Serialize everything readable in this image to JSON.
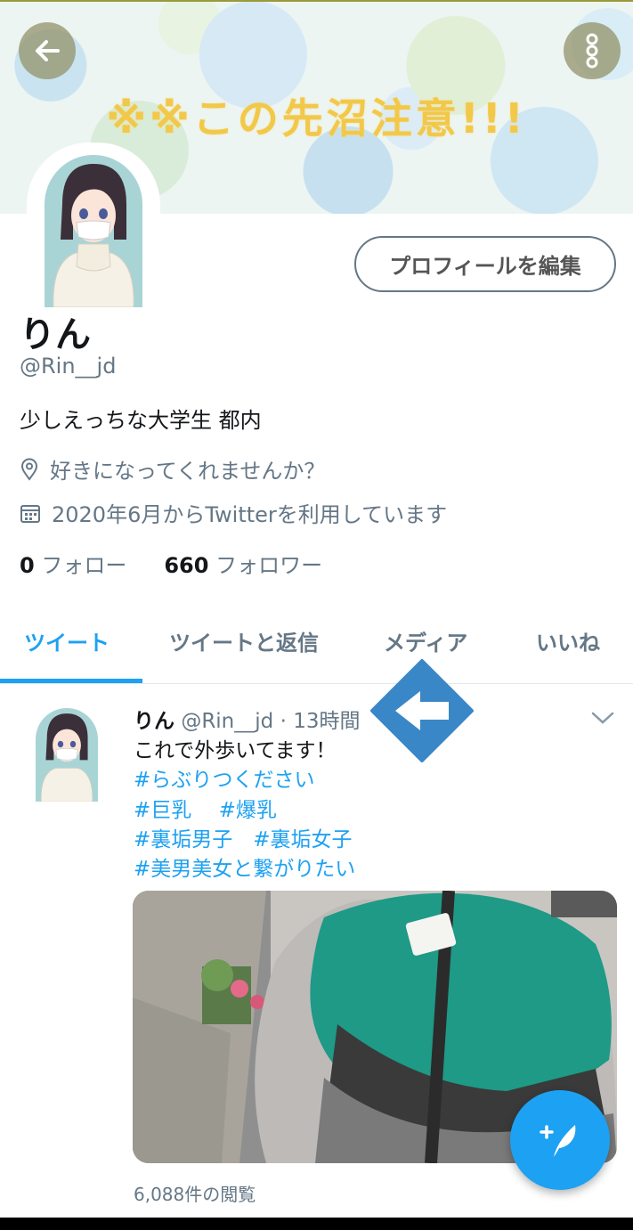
{
  "banner": {
    "text": "※※この先沼注意!!!"
  },
  "profile": {
    "edit_button_label": "プロフィールを編集",
    "name": "りん",
    "handle": "@Rin__jd",
    "bio": "少しえっちな大学生 都内",
    "location": "好きになってくれませんか？",
    "joined": "2020年6月からTwitterを利用しています",
    "following_count": "0",
    "following_label": "フォロー",
    "followers_count": "660",
    "followers_label": "フォロワー"
  },
  "tabs": [
    {
      "label": "ツイート",
      "active": true
    },
    {
      "label": "ツイートと返信",
      "active": false
    },
    {
      "label": "メディア",
      "active": false
    },
    {
      "label": "いいね",
      "active": false
    }
  ],
  "tweet": {
    "name": "りん",
    "handle": "@Rin__jd",
    "time": "· 13時間",
    "text": "これで外歩いてます！",
    "hashtags": [
      "#らぶりつください",
      "#巨乳　 #爆乳",
      "#裏垢男子　#裏垢女子",
      "#美男美女と繋がりたい"
    ],
    "views": "6,088件の閲覧"
  },
  "colors": {
    "accent": "#1da1f2",
    "secondary_text": "#657786",
    "annotation_arrow": "#3a87c8"
  },
  "icons": {
    "back": "back-arrow-icon",
    "menu": "vertical-dots-icon",
    "location": "location-pin-icon",
    "calendar": "calendar-icon",
    "chevron": "chevron-down-icon",
    "compose": "compose-tweet-icon"
  }
}
